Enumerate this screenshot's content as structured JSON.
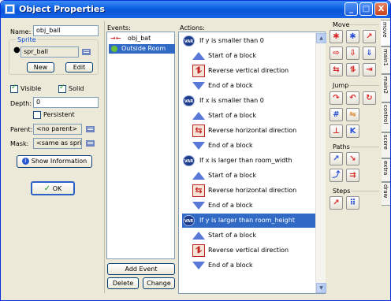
{
  "window": {
    "title": "Object Properties",
    "title_buttons": [
      "_",
      "□",
      "X"
    ]
  },
  "left": {
    "name_label": "Name:",
    "name_value": "obj_ball",
    "sprite_group_label": "Sprite",
    "sprite_value": "spr_ball",
    "new_button": "New",
    "edit_button": "Edit",
    "visible_label": "Visible",
    "visible_checked": true,
    "solid_label": "Solid",
    "solid_checked": true,
    "depth_label": "Depth:",
    "depth_value": "0",
    "persistent_label": "Persistent",
    "persistent_checked": false,
    "parent_label": "Parent:",
    "parent_value": "<no parent>",
    "mask_label": "Mask:",
    "mask_value": "<same as sprite>",
    "show_info_button": "Show Information",
    "ok_button": "OK"
  },
  "events": {
    "label": "Events:",
    "items": [
      {
        "label": "obj_bat",
        "selected": false,
        "icon": "collision-icon"
      },
      {
        "label": "Outside Room",
        "selected": true,
        "icon": "other-event-icon"
      }
    ],
    "add_button": "Add Event",
    "delete_button": "Delete",
    "change_button": "Change"
  },
  "actions": {
    "label": "Actions:",
    "items": [
      {
        "text": "If y is smaller than 0",
        "kind": "var",
        "indent": false,
        "selected": false
      },
      {
        "text": "Start of a block",
        "kind": "start",
        "indent": true
      },
      {
        "text": "Reverse vertical direction",
        "kind": "reverse-v",
        "indent": true
      },
      {
        "text": "End of a block",
        "kind": "end",
        "indent": true
      },
      {
        "text": "If x is smaller than 0",
        "kind": "var",
        "indent": false,
        "selected": false
      },
      {
        "text": "Start of a block",
        "kind": "start",
        "indent": true
      },
      {
        "text": "Reverse horizontal direction",
        "kind": "reverse-h",
        "indent": true
      },
      {
        "text": "End of a block",
        "kind": "end",
        "indent": true
      },
      {
        "text": "If x is larger than room_width",
        "kind": "var",
        "indent": false,
        "selected": false
      },
      {
        "text": "Start of a block",
        "kind": "start",
        "indent": true
      },
      {
        "text": "Reverse horizontal direction",
        "kind": "reverse-h",
        "indent": true
      },
      {
        "text": "End of a block",
        "kind": "end",
        "indent": true
      },
      {
        "text": "If y is larger than room_height",
        "kind": "var",
        "indent": false,
        "selected": true
      },
      {
        "text": "Start of a block",
        "kind": "start",
        "indent": true
      },
      {
        "text": "Reverse vertical direction",
        "kind": "reverse-v",
        "indent": true
      },
      {
        "text": "End of a block",
        "kind": "end",
        "indent": true
      }
    ],
    "var_icon_text": "VAR"
  },
  "palette": {
    "sections": [
      {
        "label": "Move"
      },
      {
        "label": "Jump"
      },
      {
        "label": "Paths"
      },
      {
        "label": "Steps"
      }
    ]
  },
  "tabs": [
    "move",
    "main1",
    "main2",
    "control",
    "score",
    "extra",
    "draw"
  ],
  "colors": {
    "title_bar": "#0a5fe3",
    "window_bg": "#ece9d8",
    "selection": "#316ac5",
    "action_icon_blue": "#5a78d8"
  }
}
